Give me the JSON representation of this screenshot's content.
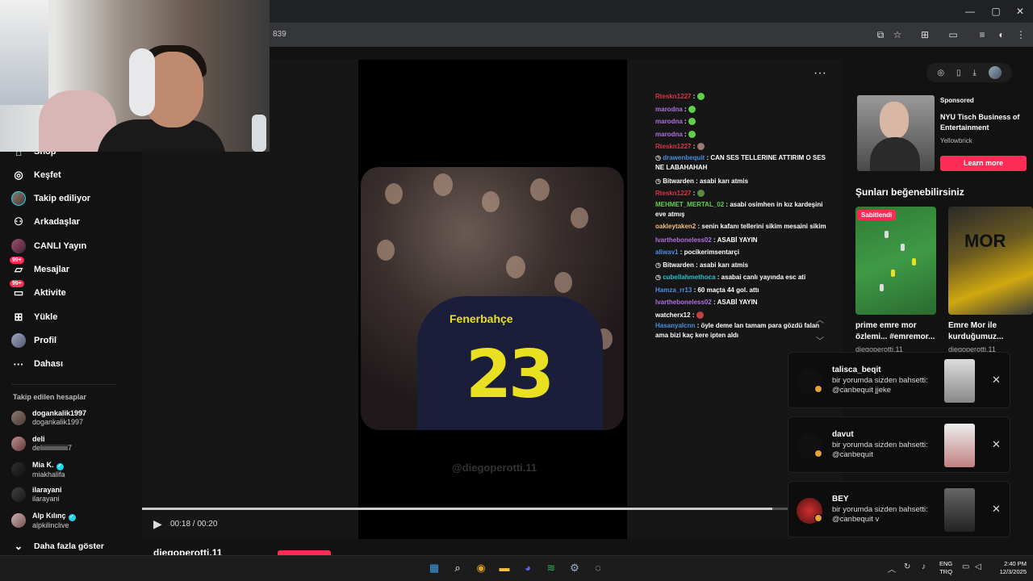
{
  "browser": {
    "url_fragment": "839"
  },
  "sidebar": {
    "items": [
      {
        "label": "Shop",
        "icon": "shop-icon"
      },
      {
        "label": "Keşfet",
        "icon": "compass-icon"
      },
      {
        "label": "Takip ediliyor",
        "icon": "following-avatar"
      },
      {
        "label": "Arkadaşlar",
        "icon": "friends-icon"
      },
      {
        "label": "CANLI Yayın",
        "icon": "live-avatar"
      },
      {
        "label": "Mesajlar",
        "icon": "message-icon",
        "badge": "99+"
      },
      {
        "label": "Aktivite",
        "icon": "activity-icon",
        "badge": "99+"
      },
      {
        "label": "Yükle",
        "icon": "upload-icon"
      },
      {
        "label": "Profil",
        "icon": "profile-avatar"
      },
      {
        "label": "Dahası",
        "icon": "more-icon"
      }
    ],
    "following_title": "Takip edilen hesaplar",
    "accounts": [
      {
        "name": "dogankalik1997",
        "handle": "dogankalik1997",
        "verified": false
      },
      {
        "name": "deli",
        "handle": "deliiiiiiiiiiiiiiii7",
        "verified": false
      },
      {
        "name": "Mia K.",
        "handle": "miakhalifa",
        "verified": true
      },
      {
        "name": "ilarayani",
        "handle": "ilarayani",
        "verified": false
      },
      {
        "name": "Alp Kılınç",
        "handle": "alpkilinclive",
        "verified": true
      }
    ],
    "show_more": "Daha fazla göster"
  },
  "video": {
    "watermark": "@diegoperotti.11",
    "time": "00:18 / 00:20",
    "progress": 0.9,
    "jersey_name": "Fenerbahçe",
    "jersey_number": "23",
    "author": "diegoperotti.11"
  },
  "chat": [
    {
      "user": "Rteskn1227",
      "text": "",
      "color": "#e0304a",
      "emote": "#5ed04a"
    },
    {
      "user": "marodna",
      "text": "",
      "color": "#b070e0",
      "emote": "#5ed04a"
    },
    {
      "user": "marodna",
      "text": "",
      "color": "#b070e0",
      "emote": "#5ed04a"
    },
    {
      "user": "marodna",
      "text": "",
      "color": "#b070e0",
      "emote": "#5ed04a"
    },
    {
      "user": "Rteskn1227",
      "text": "",
      "color": "#e0304a",
      "emote": "#9a7a70"
    },
    {
      "user": "drawenbequit",
      "text": "CAN SES TELLERINE ATTIRIM O SES NE LABAHAHAH",
      "color": "#4a90e0",
      "icon": true
    },
    {
      "user": "Bitwarden",
      "text": "asabi karı atmis",
      "color": "#ffffff",
      "icon": true
    },
    {
      "user": "Rteskn1227",
      "text": "",
      "color": "#e0304a",
      "emote": "#5a8a40"
    },
    {
      "user": "MEHMET_MERTAL_02",
      "text": "asabi osimhen in kız kardeşini eve atmış",
      "color": "#5ed04a"
    },
    {
      "user": "oakleytaken2",
      "text": "senin kafanı tellerini sikim mesaini sikim",
      "color": "#f0c080"
    },
    {
      "user": "Ivartheboneless02",
      "text": "ASABİ YAYIN",
      "color": "#b070e0"
    },
    {
      "user": "aliwav1",
      "text": "pocikerimsentarçi",
      "color": "#4a90e0"
    },
    {
      "user": "Bitwarden",
      "text": "asabi karı atmis",
      "color": "#ffffff",
      "icon": true
    },
    {
      "user": "cubellahmethoca",
      "text": "asabai canlı yayında esc ati",
      "color": "#20c0d0",
      "icon": true
    },
    {
      "user": "Hamza_rr13",
      "text": "60 maçta 44 gol. attı",
      "color": "#4a90e0"
    },
    {
      "user": "Ivartheboneless02",
      "text": "ASABİ YAYIN",
      "color": "#b070e0"
    },
    {
      "user": "watcherx12",
      "text": "",
      "color": "#ffffff",
      "emote": "#c04040"
    },
    {
      "user": "Hasanyalcnn",
      "text": "öyle deme lan tamam para gözdü falan ama bizi kaç kere ipten aldı",
      "color": "#4a90e0"
    }
  ],
  "ad": {
    "sponsored": "Sponsored",
    "title": "NYU Tisch Business of Entertainment",
    "brand": "Yellowbrick",
    "button": "Learn more"
  },
  "suggestions": {
    "title": "Şunları beğenebilirsiniz",
    "pinned": "Sabitlendi",
    "items": [
      {
        "caption": "prime emre mor özlemi... #emremor...",
        "user": "diegoperotti.11"
      },
      {
        "caption": "Emre Mor ile kurduğumuz...",
        "user": "diegoperotti.11",
        "overlay": "MOR"
      }
    ]
  },
  "notifications": [
    {
      "user": "talisca_beqit",
      "text": "bir yorumda sizden bahsetti: @canbequit jjeke"
    },
    {
      "user": "davut",
      "text": "bir yorumda sizden bahsetti: @canbequit"
    },
    {
      "user": "BEY",
      "text": "bir yorumda sizden bahsetti: @canbequit v"
    }
  ],
  "taskbar": {
    "lang": [
      "ENG",
      "TRQ"
    ],
    "time": "2:40 PM",
    "date": "12/3/2025",
    "apps": [
      {
        "name": "windows-start-icon",
        "glyph": "▦",
        "color": "#3aa0f0"
      },
      {
        "name": "search-icon",
        "glyph": "⌕",
        "color": "#ffffff"
      },
      {
        "name": "chrome-icon",
        "glyph": "◉",
        "color": "#e0a020"
      },
      {
        "name": "folder-icon",
        "glyph": "▬",
        "color": "#f0c040"
      },
      {
        "name": "discord-icon",
        "glyph": "◕",
        "color": "#5865f2"
      },
      {
        "name": "spotify-icon",
        "glyph": "≋",
        "color": "#1db954"
      },
      {
        "name": "settings-icon",
        "glyph": "⚙",
        "color": "#9ab0c8"
      },
      {
        "name": "app-icon",
        "glyph": "◌",
        "color": "#dddddd"
      }
    ]
  },
  "colors": {
    "accent": "#fe2c55",
    "background": "#121212"
  }
}
